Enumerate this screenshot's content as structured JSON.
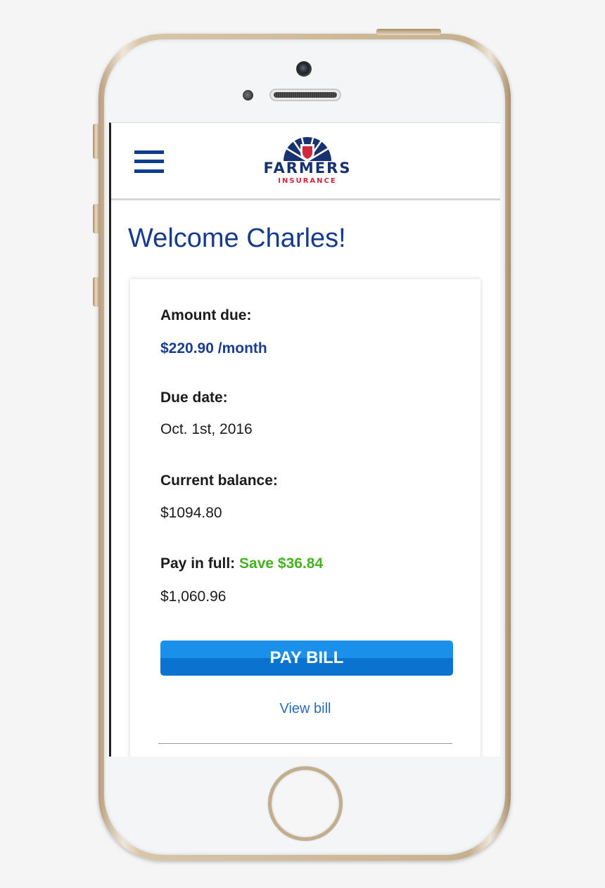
{
  "header": {
    "logo_word": "FARMERS",
    "logo_sub": "INSURANCE",
    "logo_icon": "farmers-shield-icon",
    "menu_icon": "hamburger-menu-icon"
  },
  "welcome": "Welcome Charles!",
  "billing": {
    "amount_due_label": "Amount due:",
    "amount_due_value": "$220.90 /month",
    "due_date_label": "Due date:",
    "due_date_value": "Oct. 1st, 2016",
    "current_balance_label": "Current balance:",
    "current_balance_value": "$1094.80",
    "pay_in_full_label": "Pay in full:",
    "pay_in_full_savings": "Save $36.84",
    "pay_in_full_value": "$1,060.96",
    "pay_button": "PAY BILL",
    "view_bill": "View bill"
  },
  "colors": {
    "brand_blue": "#1a3d8f",
    "brand_red": "#d2273c",
    "savings_green": "#45b21f",
    "button_blue": "#1b90ea",
    "link_blue": "#2b6cb8"
  }
}
